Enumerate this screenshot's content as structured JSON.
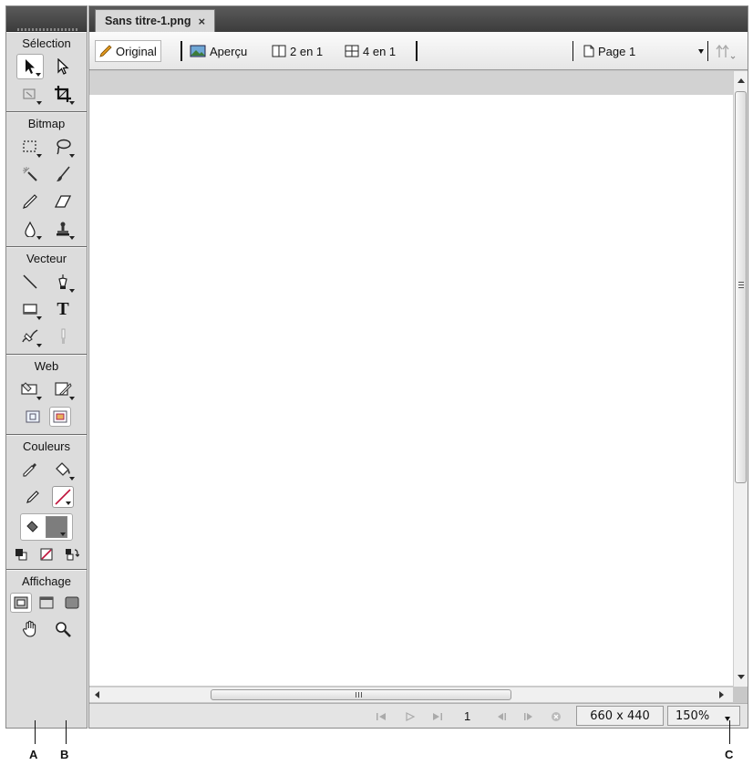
{
  "document_tab": {
    "title": "Sans titre-1.png",
    "close": "×"
  },
  "view_bar": {
    "original": "Original",
    "apercu": "Aperçu",
    "two_up": "2 en 1",
    "four_up": "4 en 1",
    "page": "Page 1"
  },
  "tools": {
    "selection_title": "Sélection",
    "bitmap_title": "Bitmap",
    "vecteur_title": "Vecteur",
    "web_title": "Web",
    "couleurs_title": "Couleurs",
    "affichage_title": "Affichage",
    "text_tool_glyph": "T"
  },
  "status_bar": {
    "frame_number": "1",
    "canvas_size": "660 x 440",
    "zoom": "150%"
  },
  "callouts": {
    "a": "A",
    "b": "B",
    "c": "C"
  },
  "colors": {
    "chrome_dark": "#3c3c3c",
    "panel_bg": "#dcdcdc",
    "stroke_red": "#c0143c"
  }
}
